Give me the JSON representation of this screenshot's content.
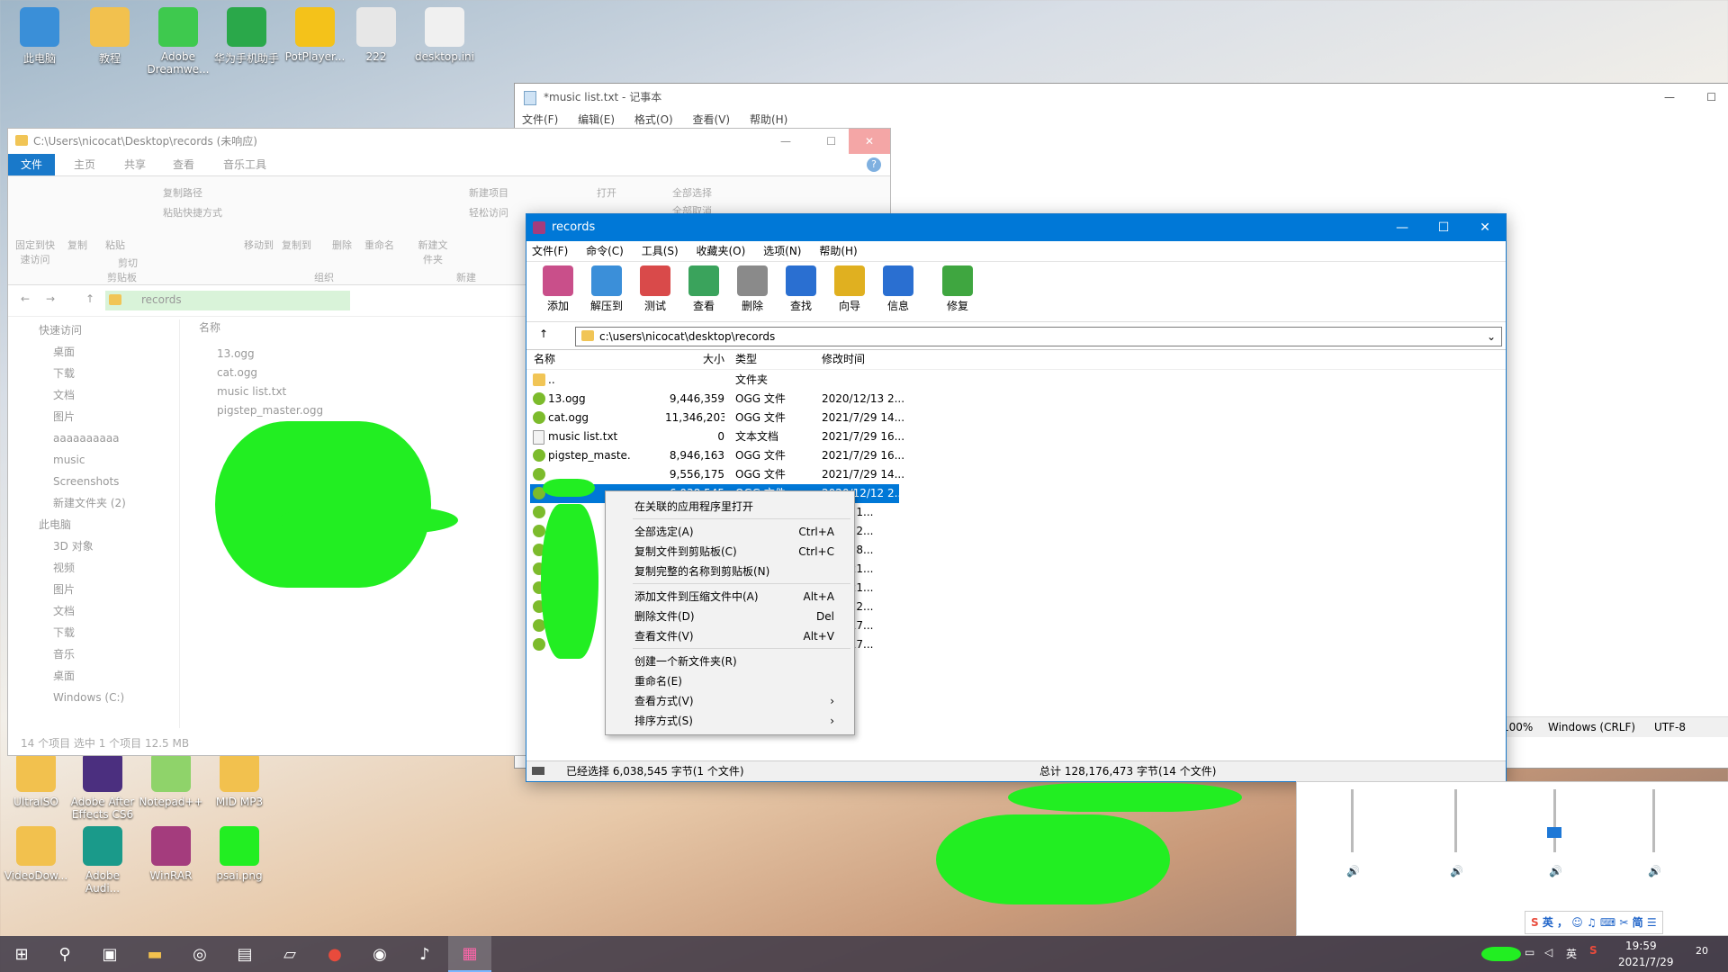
{
  "desktop": {
    "icons_top": [
      {
        "label": "此电脑",
        "color": "#3a8fd8"
      },
      {
        "label": "教程",
        "color": "#f2c14e"
      },
      {
        "label": "Adobe Dreamwe...",
        "color": "#3ec94e"
      },
      {
        "label": "华为手机助手",
        "color": "#2aa84a"
      },
      {
        "label": "PotPlayer...",
        "color": "#f4c21a"
      },
      {
        "label": "222",
        "color": "#e7e7e7"
      },
      {
        "label": "desktop.ini",
        "color": "#f0f0f0"
      }
    ],
    "icons_bottom": [
      {
        "label": "UltraISO",
        "color": "#f2c14e"
      },
      {
        "label": "Adobe After Effects CS6",
        "color": "#4b2f7f"
      },
      {
        "label": "Notepad++",
        "color": "#8fd36a"
      },
      {
        "label": "MID MP3",
        "color": "#f2c14e"
      },
      {
        "label": "VideoDow...",
        "color": "#f2c14e"
      },
      {
        "label": "Adobe Audi...",
        "color": "#1a9a8a"
      },
      {
        "label": "WinRAR",
        "color": "#a43c7d"
      },
      {
        "label": "psai.png",
        "color": "#22ee22"
      }
    ]
  },
  "notepad": {
    "title": "*music list.txt - 记事本",
    "menu": [
      "文件(F)",
      "编辑(E)",
      "格式(O)",
      "查看(V)",
      "帮助(H)"
    ],
    "status": {
      "zoom": "100%",
      "eol": "Windows (CRLF)",
      "enc": "UTF-8"
    }
  },
  "explorer": {
    "title": "C:\\Users\\nicocat\\Desktop\\records (未响应)",
    "tabs": [
      "文件",
      "主页",
      "共享",
      "查看",
      "音乐工具"
    ],
    "ribbon": {
      "pin": "固定到快速访问",
      "copy": "复制",
      "paste": "粘贴",
      "copy_path": "复制路径",
      "paste_shortcut": "粘贴快捷方式",
      "cut": "剪切",
      "move_to": "移动到",
      "copy_to": "复制到",
      "delete": "删除",
      "rename": "重命名",
      "new_folder": "新建文件夹",
      "new_item": "新建项目",
      "easy_access": "轻松访问",
      "open": "打开",
      "select_all": "全部选择",
      "select_none": "全部取消",
      "groups": [
        "剪贴板",
        "组织",
        "新建"
      ]
    },
    "address": "records",
    "nav": [
      "快速访问",
      "桌面",
      "下载",
      "文档",
      "图片",
      "aaaaaaaaaa",
      "music",
      "Screenshots",
      "新建文件夹 (2)",
      "此电脑",
      "3D 对象",
      "视频",
      "图片",
      "文档",
      "下载",
      "音乐",
      "桌面",
      "Windows (C:)"
    ],
    "column": "名称",
    "files": [
      "13.ogg",
      "cat.ogg",
      "music list.txt",
      "pigstep_master.ogg"
    ],
    "status": "14 个项目   选中 1 个项目  12.5 MB"
  },
  "winrar": {
    "title": "records",
    "menu": [
      "文件(F)",
      "命令(C)",
      "工具(S)",
      "收藏夹(O)",
      "选项(N)",
      "帮助(H)"
    ],
    "tools": [
      {
        "label": "添加",
        "color": "#c94f8a"
      },
      {
        "label": "解压到",
        "color": "#3b8fd9"
      },
      {
        "label": "测试",
        "color": "#d94a4a"
      },
      {
        "label": "查看",
        "color": "#3aa35c"
      },
      {
        "label": "删除",
        "color": "#8a8a8a"
      },
      {
        "label": "查找",
        "color": "#2a6fd1"
      },
      {
        "label": "向导",
        "color": "#e0b020"
      },
      {
        "label": "信息",
        "color": "#2a6fd1"
      },
      {
        "label": "修复",
        "color": "#3fa640"
      }
    ],
    "path": "c:\\users\\nicocat\\desktop\\records",
    "headers": {
      "name": "名称",
      "size": "大小",
      "type": "类型",
      "modified": "修改时间"
    },
    "rows": [
      {
        "name": "..",
        "size": "",
        "type": "文件夹",
        "date": "",
        "kind": "folder"
      },
      {
        "name": "13.ogg",
        "size": "9,446,359",
        "type": "OGG 文件",
        "date": "2020/12/13 2...",
        "kind": "ogg"
      },
      {
        "name": "cat.ogg",
        "size": "11,346,203",
        "type": "OGG 文件",
        "date": "2021/7/29 14...",
        "kind": "ogg"
      },
      {
        "name": "music list.txt",
        "size": "0",
        "type": "文本文档",
        "date": "2021/7/29 16...",
        "kind": "txt"
      },
      {
        "name": "pigstep_maste...",
        "size": "8,946,163",
        "type": "OGG 文件",
        "date": "2021/7/29 16...",
        "kind": "ogg"
      },
      {
        "name": "",
        "size": "9,556,175",
        "type": "OGG 文件",
        "date": "2021/7/29 14...",
        "kind": "ogg"
      },
      {
        "name": "",
        "size": "6,038,545",
        "type": "OGG 文件",
        "date": "2020/12/12 2...",
        "kind": "ogg",
        "selected": true
      },
      {
        "name": "",
        "size": "",
        "type": "",
        "date": "12/20 1...",
        "kind": "ogg"
      },
      {
        "name": "",
        "size": "",
        "type": "",
        "date": "12/13 2...",
        "kind": "ogg"
      },
      {
        "name": "",
        "size": "",
        "type": "",
        "date": "12/20 8...",
        "kind": "ogg"
      },
      {
        "name": "",
        "size": "",
        "type": "",
        "date": "12/5 21...",
        "kind": "ogg"
      },
      {
        "name": "",
        "size": "",
        "type": "",
        "date": "12/5 21...",
        "kind": "ogg"
      },
      {
        "name": "",
        "size": "",
        "type": "",
        "date": "12/13 2...",
        "kind": "ogg"
      },
      {
        "name": "",
        "size": "",
        "type": "",
        "date": "4/19 17...",
        "kind": "ogg"
      },
      {
        "name": "",
        "size": "",
        "type": "",
        "date": "7/29 17...",
        "kind": "ogg"
      }
    ],
    "status_left": "已经选择 6,038,545 字节(1 个文件)",
    "status_right": "总计 128,176,473 字节(14 个文件)"
  },
  "context_menu": [
    {
      "label": "在关联的应用程序里打开",
      "shortcut": ""
    },
    {
      "sep": true
    },
    {
      "label": "全部选定(A)",
      "shortcut": "Ctrl+A"
    },
    {
      "label": "复制文件到剪贴板(C)",
      "shortcut": "Ctrl+C"
    },
    {
      "label": "复制完整的名称到剪贴板(N)",
      "shortcut": ""
    },
    {
      "sep": true
    },
    {
      "label": "添加文件到压缩文件中(A)",
      "shortcut": "Alt+A"
    },
    {
      "label": "删除文件(D)",
      "shortcut": "Del"
    },
    {
      "label": "查看文件(V)",
      "shortcut": "Alt+V"
    },
    {
      "sep": true
    },
    {
      "label": "创建一个新文件夹(R)",
      "shortcut": ""
    },
    {
      "label": "重命名(E)",
      "shortcut": ""
    },
    {
      "label": "查看方式(V)",
      "shortcut": "›"
    },
    {
      "label": "排序方式(S)",
      "shortcut": "›"
    }
  ],
  "tray": {
    "ime": "英",
    "ime2": "简",
    "ime3": "英",
    "time": "19:59",
    "date": "2021/7/29",
    "notif_count": "20"
  }
}
